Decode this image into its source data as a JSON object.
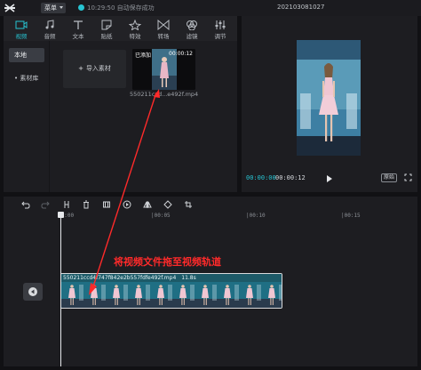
{
  "titlebar": {
    "menu_label": "菜单",
    "save_status": "10:29:50 自动保存成功",
    "project_title": "202103081027"
  },
  "media_tabs": [
    {
      "label": "视频",
      "icon": "video-icon",
      "active": true
    },
    {
      "label": "音频",
      "icon": "audio-icon",
      "active": false
    },
    {
      "label": "文本",
      "icon": "text-icon",
      "active": false
    },
    {
      "label": "贴纸",
      "icon": "sticker-icon",
      "active": false
    },
    {
      "label": "特效",
      "icon": "effects-icon",
      "active": false
    },
    {
      "label": "转场",
      "icon": "transition-icon",
      "active": false
    },
    {
      "label": "滤镜",
      "icon": "filter-icon",
      "active": false
    },
    {
      "label": "调节",
      "icon": "adjust-icon",
      "active": false
    }
  ],
  "sidebar": {
    "items": [
      {
        "label": "本地",
        "active": true
      },
      {
        "label": "• 素材库",
        "active": false
      }
    ]
  },
  "media": {
    "import_label": "导入素材",
    "thumb_tag_left": "已添加",
    "thumb_tag_right": "00:00:12",
    "file_name": "550211ccd...e492f.mp4"
  },
  "player": {
    "current_time": "00:00:00",
    "total_time": "00:00:12",
    "ratio_label": "原始"
  },
  "timeline": {
    "ruler_labels": [
      "00:00",
      "|00:05",
      "|00:10",
      "|00:15"
    ],
    "clip_name": "550211ccd4f747f842e2b557fdfe492f.mp4",
    "clip_duration": "11.8s"
  },
  "annotation": {
    "text": "将视频文件拖至视频轨道",
    "color": "#ff2a2a"
  },
  "colors": {
    "accent": "#27c4d2",
    "panel": "#1d1d21",
    "background": "#111114"
  }
}
